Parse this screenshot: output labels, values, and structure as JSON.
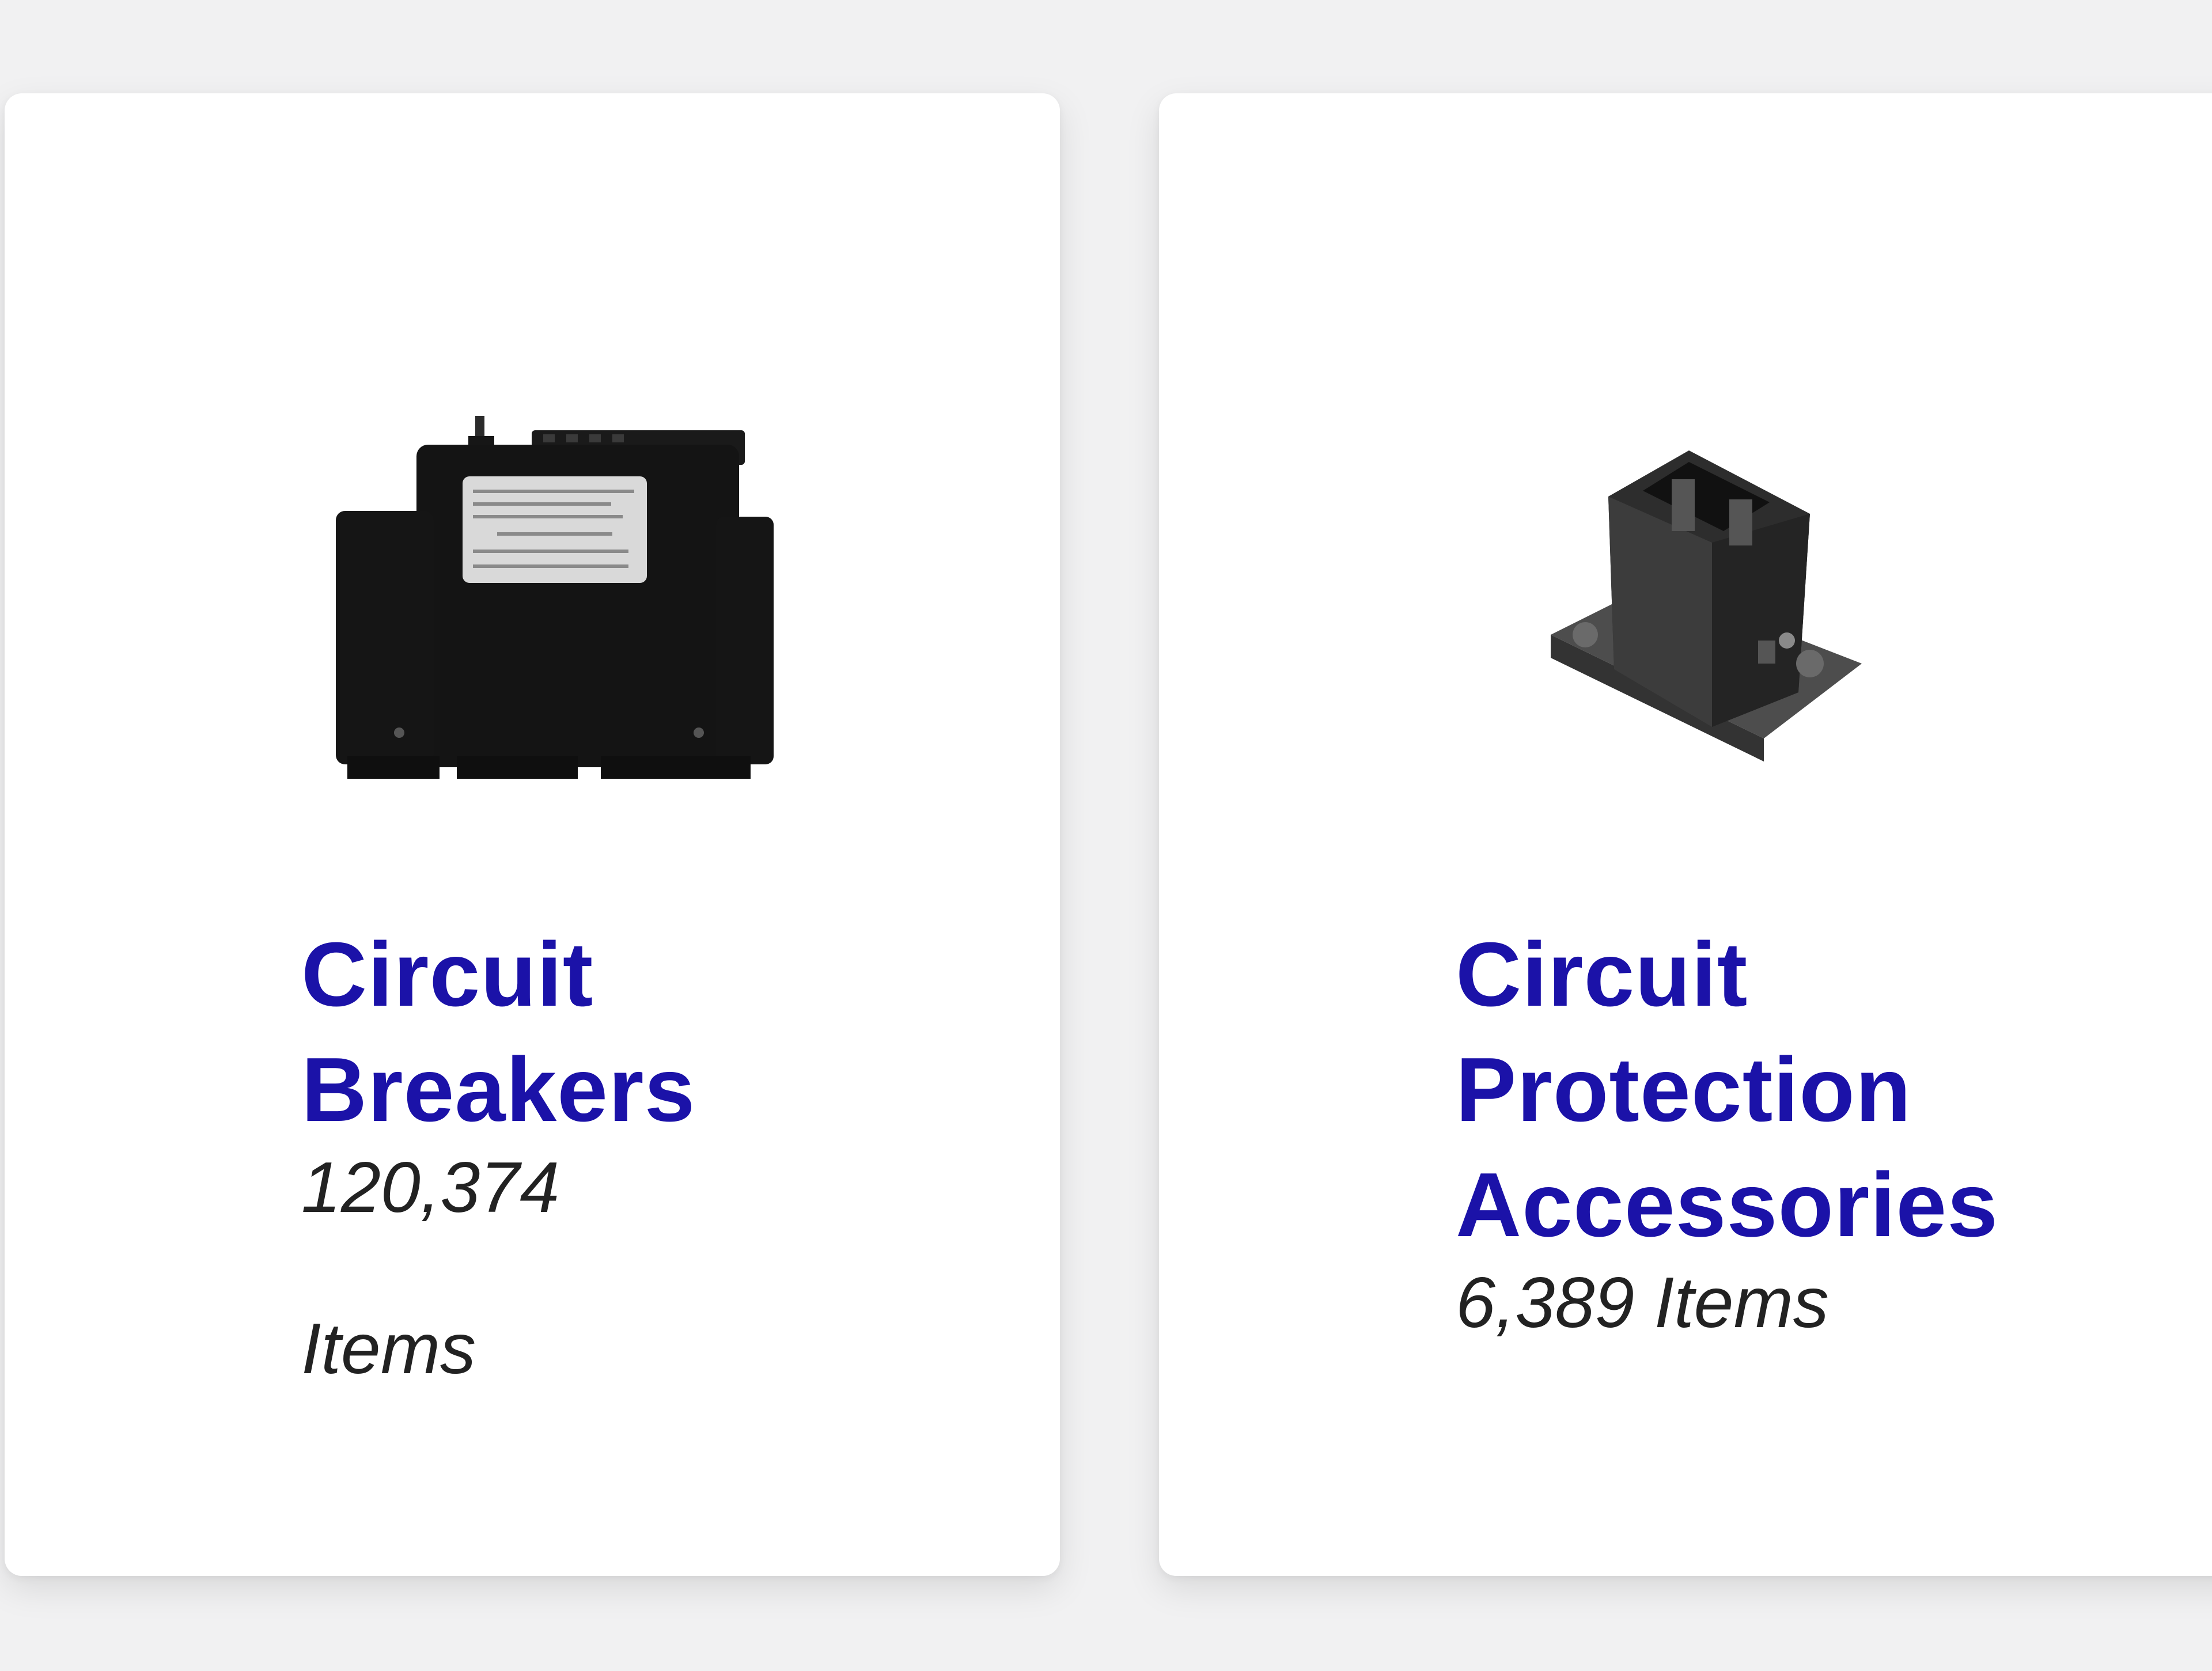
{
  "cards": [
    {
      "title_lines": [
        "Circuit",
        "Breakers"
      ],
      "count": "120,374",
      "unit": "Items",
      "icon": "circuit-breaker-image"
    },
    {
      "title_lines": [
        "Circuit",
        "Protection",
        "Accessories"
      ],
      "count_text": "6,389 Items",
      "icon": "circuit-protection-accessory-image"
    }
  ],
  "colors": {
    "title": "#1b12a8",
    "count": "#222222",
    "card_bg": "#ffffff",
    "page_bg": "#f1f1f2"
  }
}
